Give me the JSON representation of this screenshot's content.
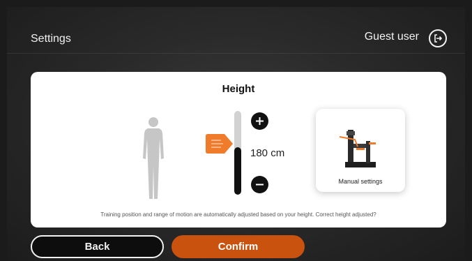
{
  "header": {
    "title": "Settings",
    "user_label": "Guest user",
    "logout_icon": "logout-icon"
  },
  "card": {
    "title": "Height",
    "height_value": "180 cm",
    "height_fill_fraction": 0.57,
    "plus_icon": "plus-icon",
    "minus_icon": "minus-icon",
    "manual_settings_label": "Manual settings",
    "hint": "Training position and range of motion are automatically adjusted based on your height. Correct height adjusted?"
  },
  "footer": {
    "back_label": "Back",
    "confirm_label": "Confirm"
  },
  "colors": {
    "accent": "#c9520f",
    "pointer": "#f07b2a"
  }
}
